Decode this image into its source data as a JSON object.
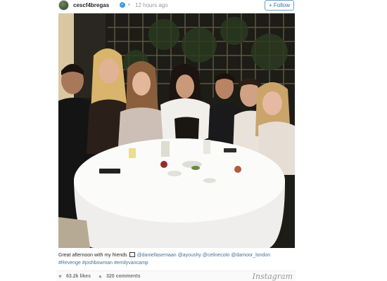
{
  "post": {
    "username": "cescf4bregas",
    "time_ago": "12 hours ago",
    "follow_label": "+ Follow",
    "caption": {
      "text": "Great afternoon with my friends",
      "mentions": [
        "@daniellasemaan",
        "@ayoushy",
        "@celinecotn",
        "@damoor_london"
      ],
      "hashtags": [
        "#Revenge",
        "#joshbowman",
        "#emilyvancamp"
      ]
    },
    "likes": "63.2k likes",
    "comments": "320 comments",
    "brand": "Instagram"
  },
  "icons": {
    "verified": "verified-badge-icon",
    "heart": "heart-icon",
    "comment": "comment-icon"
  },
  "colors": {
    "link": "#3f729b",
    "verified": "#3897f0"
  }
}
